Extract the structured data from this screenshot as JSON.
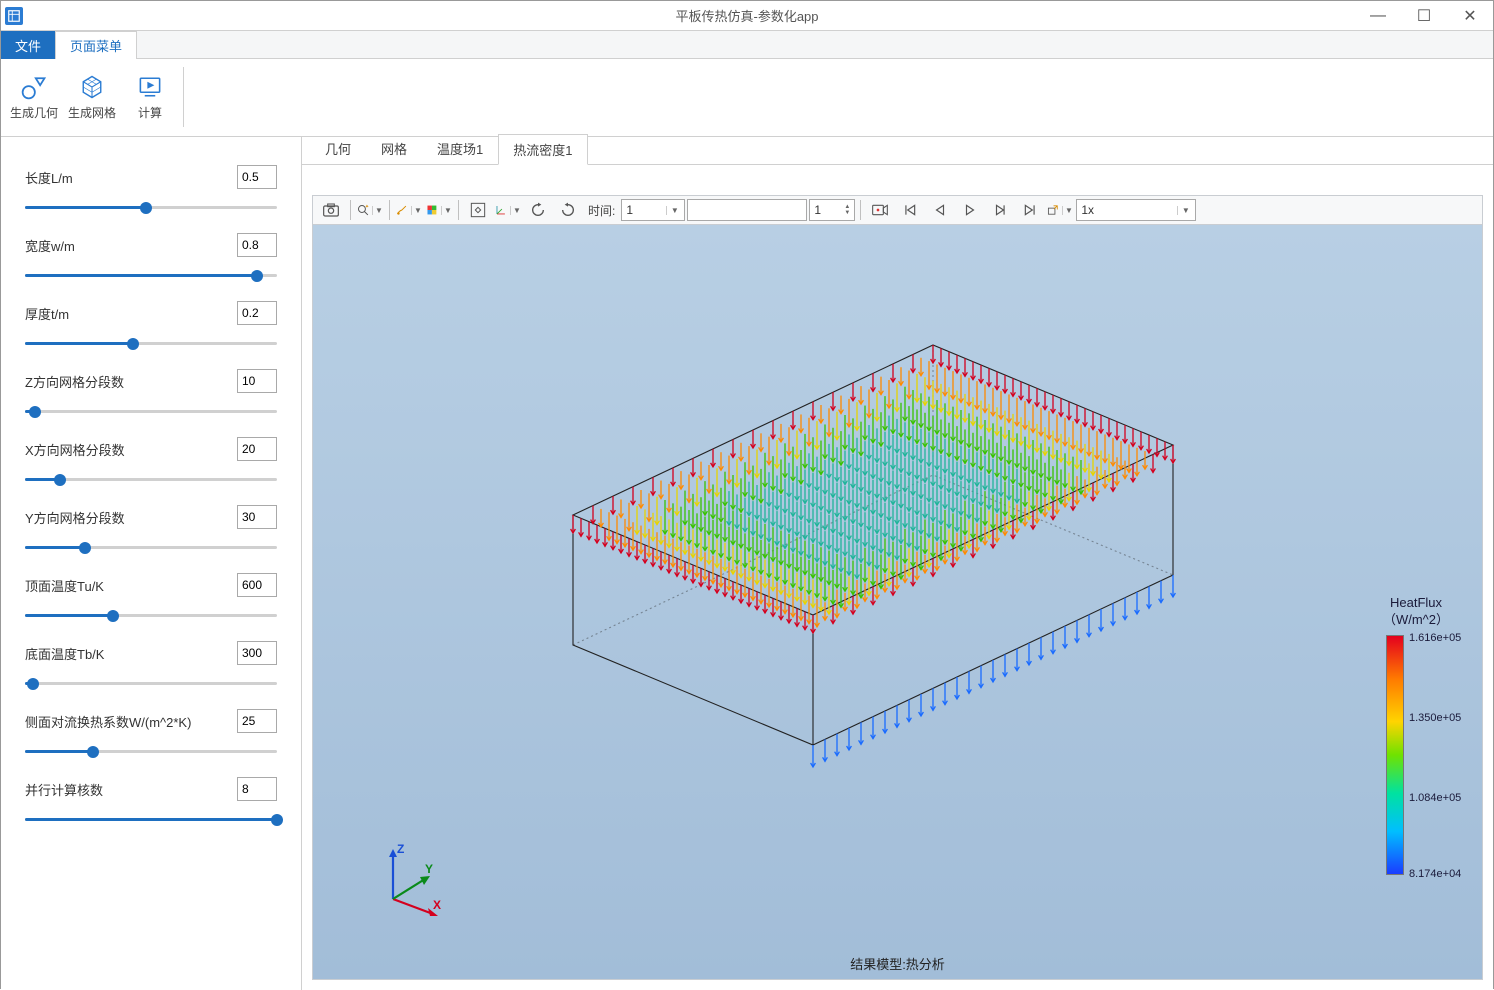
{
  "window": {
    "title": "平板传热仿真-参数化app",
    "min_label": "—",
    "max_label": "☐",
    "close_label": "✕"
  },
  "menu": {
    "file": "文件",
    "page_menu": "页面菜单"
  },
  "ribbon": {
    "gen_geometry": "生成几何",
    "gen_mesh": "生成网格",
    "compute": "计算"
  },
  "params": [
    {
      "label": "长度L/m",
      "value": "0.5",
      "fill": 48
    },
    {
      "label": "宽度w/m",
      "value": "0.8",
      "fill": 92
    },
    {
      "label": "厚度t/m",
      "value": "0.2",
      "fill": 43
    },
    {
      "label": "Z方向网格分段数",
      "value": "10",
      "fill": 4
    },
    {
      "label": "X方向网格分段数",
      "value": "20",
      "fill": 14
    },
    {
      "label": "Y方向网格分段数",
      "value": "30",
      "fill": 24
    },
    {
      "label": "顶面温度Tu/K",
      "value": "600",
      "fill": 35
    },
    {
      "label": "底面温度Tb/K",
      "value": "300",
      "fill": 3
    },
    {
      "label": "侧面对流换热系数W/(m^2*K)",
      "value": "25",
      "fill": 27
    },
    {
      "label": "并行计算核数",
      "value": "8",
      "fill": 100
    }
  ],
  "tabs": {
    "geometry": "几何",
    "mesh": "网格",
    "temperature": "温度场1",
    "heatflux": "热流密度1"
  },
  "toolbar": {
    "time_label": "时间:",
    "time_value": "1",
    "frame_value": "1",
    "speed_value": "1x"
  },
  "legend": {
    "title": "HeatFlux\n（W/m^2）",
    "ticks": [
      "1.616e+05",
      "1.350e+05",
      "1.084e+05",
      "8.174e+04"
    ]
  },
  "caption": "结果模型:热分析",
  "axes": {
    "x": "X",
    "y": "Y",
    "z": "Z"
  }
}
